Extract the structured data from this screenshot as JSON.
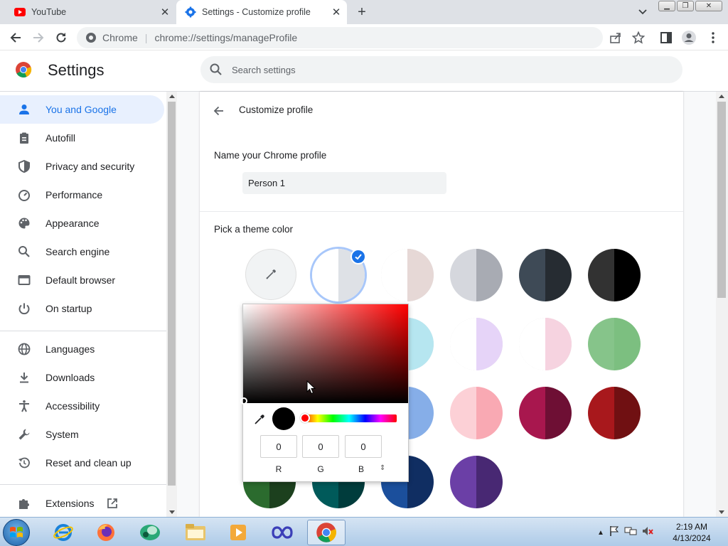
{
  "browser": {
    "tabs": [
      {
        "title": "YouTube",
        "active": false
      },
      {
        "title": "Settings - Customize profile",
        "active": true
      }
    ],
    "omnibox": {
      "site": "Chrome",
      "url": "chrome://settings/manageProfile"
    }
  },
  "settings": {
    "title": "Settings",
    "search_placeholder": "Search settings"
  },
  "sidebar": {
    "items": [
      {
        "label": "You and Google",
        "icon": "person-icon",
        "active": true
      },
      {
        "label": "Autofill",
        "icon": "clipboard-icon"
      },
      {
        "label": "Privacy and security",
        "icon": "shield-icon"
      },
      {
        "label": "Performance",
        "icon": "gauge-icon"
      },
      {
        "label": "Appearance",
        "icon": "palette-icon"
      },
      {
        "label": "Search engine",
        "icon": "search-icon"
      },
      {
        "label": "Default browser",
        "icon": "browser-window-icon"
      },
      {
        "label": "On startup",
        "icon": "power-icon"
      },
      {
        "label": "Languages",
        "icon": "globe-icon"
      },
      {
        "label": "Downloads",
        "icon": "download-icon"
      },
      {
        "label": "Accessibility",
        "icon": "accessibility-icon"
      },
      {
        "label": "System",
        "icon": "wrench-icon"
      },
      {
        "label": "Reset and clean up",
        "icon": "restore-icon"
      },
      {
        "label": "Extensions",
        "icon": "puzzle-icon"
      }
    ]
  },
  "profile": {
    "subpage_title": "Customize profile",
    "name_label": "Name your Chrome profile",
    "name_value": "Person 1",
    "theme_label": "Pick a theme color",
    "swatches": [
      {
        "left": "#ffffff",
        "right": "#dee1e6",
        "selected": true
      },
      {
        "left": "#ffffff",
        "right": "#e6d8d6"
      },
      {
        "left": "#d5d7dd",
        "right": "#a8abb3"
      },
      {
        "left": "#3e4a56",
        "right": "#262c32"
      },
      {
        "left": "#323232",
        "right": "#000000"
      },
      {
        "left": "#ffffff",
        "right": "#d0ecd0"
      },
      {
        "left": "#ffffff",
        "right": "#b6e6f0"
      },
      {
        "left": "#ffffff",
        "right": "#e6d4f8"
      },
      {
        "left": "#ffffff",
        "right": "#f6d3e0"
      },
      {
        "left": "#86c48a",
        "right": "#7cbf80"
      },
      {
        "left": "#a8dedc",
        "right": "#5dbac0"
      },
      {
        "left": "#c6d8f6",
        "right": "#86aee8"
      },
      {
        "left": "#fcd0d6",
        "right": "#f9a9b3"
      },
      {
        "left": "#a8174e",
        "right": "#6e0f34"
      },
      {
        "left": "#a8181c",
        "right": "#701012"
      },
      {
        "left": "#2b6b2e",
        "right": "#1c401e"
      },
      {
        "left": "#005a5a",
        "right": "#003c3c"
      },
      {
        "left": "#1b4f9c",
        "right": "#102e62"
      },
      {
        "left": "#6b3fa6",
        "right": "#482873"
      }
    ]
  },
  "color_picker": {
    "r": "0",
    "g": "0",
    "b": "0",
    "r_label": "R",
    "g_label": "G",
    "b_label": "B",
    "format_toggle": "⇕"
  },
  "taskbar": {
    "time": "2:19 AM",
    "date": "4/13/2024"
  }
}
